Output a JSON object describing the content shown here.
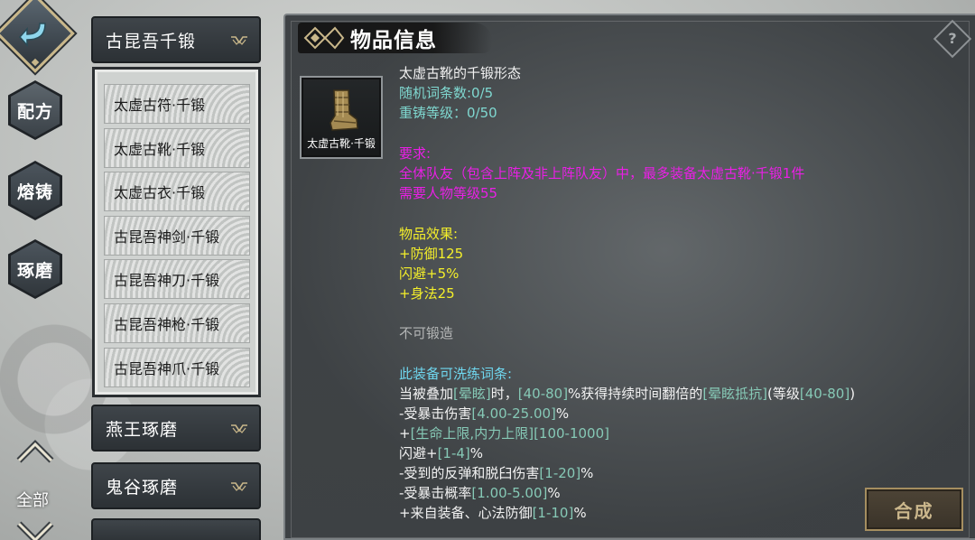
{
  "nav": {
    "back_icon": "back-arrow-icon",
    "tabs": [
      {
        "label": "配方"
      },
      {
        "label": "熔铸"
      },
      {
        "label": "琢磨"
      }
    ],
    "all_label": "全部"
  },
  "categories": {
    "active": {
      "label": "古昆吾千锻",
      "items": [
        {
          "label": "太虚古符·千锻"
        },
        {
          "label": "太虚古靴·千锻"
        },
        {
          "label": "太虚古衣·千锻"
        },
        {
          "label": "古昆吾神剑·千锻"
        },
        {
          "label": "古昆吾神刀·千锻"
        },
        {
          "label": "古昆吾神枪·千锻"
        },
        {
          "label": "古昆吾神爪·千锻"
        }
      ]
    },
    "others": [
      {
        "label": "燕王琢磨"
      },
      {
        "label": "鬼谷琢磨"
      },
      {
        "label": ""
      }
    ]
  },
  "panel": {
    "title": "物品信息",
    "help": "?",
    "item_icon_label": "太虚古靴·千锻",
    "item_name": "太虚古靴的千锻形态",
    "random_affix": "随机词条数:0/5",
    "reforge_level": "重铸等级：0/50",
    "req_title": "要求:",
    "req_line1": "全体队友（包含上阵及非上阵队友）中，最多装备太虚古靴·千锻1件",
    "req_line2": "需要人物等级55",
    "effect_title": "物品效果:",
    "effects": [
      "+防御125",
      "闪避+5%",
      "+身法25"
    ],
    "not_forgeable": "不可锻造",
    "affix_title": "此装备可洗练词条:",
    "affixes": {
      "a1": {
        "p1": "当被叠加",
        "p2": "[晕眩]",
        "p3": "时，",
        "p4": "[40-80]",
        "p5": "%获得持续时间翻倍的",
        "p6": "[晕眩抵抗]",
        "p7": "(等级",
        "p8": "[40-80]",
        "p9": ")"
      },
      "a2": {
        "p1": "-受暴击伤害",
        "p2": "[4.00-25.00]",
        "p3": "%"
      },
      "a3": {
        "p1": "+",
        "p2": "[生命上限,内力上限]",
        "p3": "[100-1000]"
      },
      "a4": {
        "p1": "闪避+",
        "p2": "[1-4]",
        "p3": "%"
      },
      "a5": {
        "p1": "-受到的反弹和脱臼伤害",
        "p2": "[1-20]",
        "p3": "%"
      },
      "a6": {
        "p1": "-受暴击概率",
        "p2": "[1.00-5.00]",
        "p3": "%"
      },
      "a7": {
        "p1": "+来自装备、心法防御",
        "p2": "[1-10]",
        "p3": "%"
      }
    },
    "craft_button": "合成"
  },
  "colors": {
    "requirement": "#ea1fe6",
    "effect": "#f4ef2a",
    "affix_title": "#6fd7ef",
    "affix_range": "#86c9b6",
    "stat_cyan": "#7fd8d0",
    "craft_gold": "#cbb78c"
  }
}
